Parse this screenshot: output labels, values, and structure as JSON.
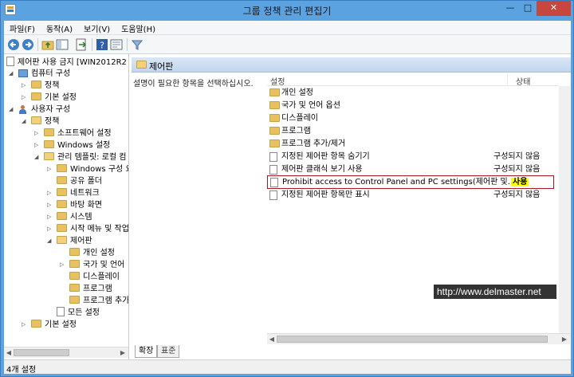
{
  "window": {
    "title": "그룹 정책 관리 편집기",
    "min": "—",
    "max": "□",
    "close": "✕"
  },
  "menu": [
    "파일(F)",
    "동작(A)",
    "보기(V)",
    "도움말(H)"
  ],
  "tree": {
    "items": [
      {
        "label": "제어판 사용 금지 [WIN2012R2",
        "icon": "policy-doc-icon"
      },
      {
        "label": "컴퓨터 구성",
        "icon": "computer-icon"
      },
      {
        "label": "정책",
        "icon": "folder-icon"
      },
      {
        "label": "기본 설정",
        "icon": "folder-icon"
      },
      {
        "label": "사용자 구성",
        "icon": "user-icon"
      },
      {
        "label": "정책",
        "icon": "folder-icon"
      },
      {
        "label": "소프트웨어 설정",
        "icon": "folder-icon"
      },
      {
        "label": "Windows 설정",
        "icon": "folder-icon"
      },
      {
        "label": "관리 템플릿: 로컬 컴",
        "icon": "folder-icon"
      },
      {
        "label": "Windows 구성 요",
        "icon": "folder-icon"
      },
      {
        "label": "공유 폴더",
        "icon": "folder-icon"
      },
      {
        "label": "네트워크",
        "icon": "folder-icon"
      },
      {
        "label": "바탕 화면",
        "icon": "folder-icon"
      },
      {
        "label": "시스템",
        "icon": "folder-icon"
      },
      {
        "label": "시작 메뉴 및 작업",
        "icon": "folder-icon"
      },
      {
        "label": "제어판",
        "icon": "folder-open-icon"
      },
      {
        "label": "개인 설정",
        "icon": "folder-icon"
      },
      {
        "label": "국가 및 언어",
        "icon": "folder-icon"
      },
      {
        "label": "디스플레이",
        "icon": "folder-icon"
      },
      {
        "label": "프로그램",
        "icon": "folder-icon"
      },
      {
        "label": "프로그램 추가",
        "icon": "folder-icon"
      },
      {
        "label": "모든 설정",
        "icon": "policy-doc-icon"
      },
      {
        "label": "기본 설정",
        "icon": "folder-icon"
      }
    ]
  },
  "detail": {
    "header": "제어판",
    "description": "설명이 필요한 항목을 선택하십시오.",
    "columns": {
      "setting": "설정",
      "state": "상태"
    },
    "rows": [
      {
        "name": "개인 설정",
        "state": "",
        "icon": "folder-icon"
      },
      {
        "name": "국가 및 언어 옵션",
        "state": "",
        "icon": "folder-icon"
      },
      {
        "name": "디스플레이",
        "state": "",
        "icon": "folder-icon"
      },
      {
        "name": "프로그램",
        "state": "",
        "icon": "folder-icon"
      },
      {
        "name": "프로그램 추가/제거",
        "state": "",
        "icon": "folder-icon"
      },
      {
        "name": "지정된 제어판 항목 숨기기",
        "state": "구성되지 않음",
        "icon": "policy-doc-icon"
      },
      {
        "name": "제어판 클래식 보기 사용",
        "state": "구성되지 않음",
        "icon": "policy-doc-icon"
      },
      {
        "name": "Prohibit access to Control Panel and PC settings(제어판 및...",
        "state": "사용",
        "icon": "policy-doc-icon",
        "selected": true
      },
      {
        "name": "지정된 제어판 항목만 표시",
        "state": "구성되지 않음",
        "icon": "policy-doc-icon"
      }
    ],
    "tabs": [
      "확장",
      "표준"
    ]
  },
  "status": "4개 설정",
  "watermark": "http://www.delmaster.net"
}
